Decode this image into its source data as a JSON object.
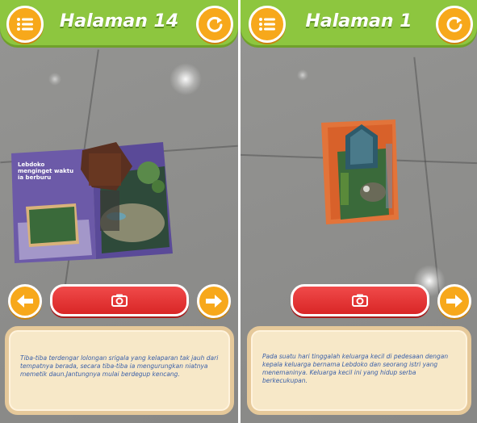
{
  "left_panel": {
    "title": "Halaman 14",
    "book_heading": "Lebdoko menginget waktu ia berburu",
    "story_text": "Tiba-tiba terdengar lolongan srigala yang kelaparan tak jauh dari tempatnya berada, secara tiba-tiba ia mengurungkan niatnya memetik daun.Jantungnya mulai berdegup kencang."
  },
  "right_panel": {
    "title": "Halaman 1",
    "story_text": "Pada suatu hari tinggalah keluarga kecil di pedesaan dengan kepala keluarga bernama Lebdoko dan seorang istri yang menemaninya. Keluarga kecil ini yang hidup serba berkecukupan."
  },
  "colors": {
    "topbar": "#8dc63f",
    "button_orange": "#f7a81b",
    "shutter_red": "#e03030",
    "textbox_bg": "#f7e8c8",
    "story_text": "#3a5fa8"
  },
  "icons": [
    "menu-list-icon",
    "refresh-icon",
    "camera-icon",
    "arrow-left-icon",
    "arrow-right-icon"
  ]
}
